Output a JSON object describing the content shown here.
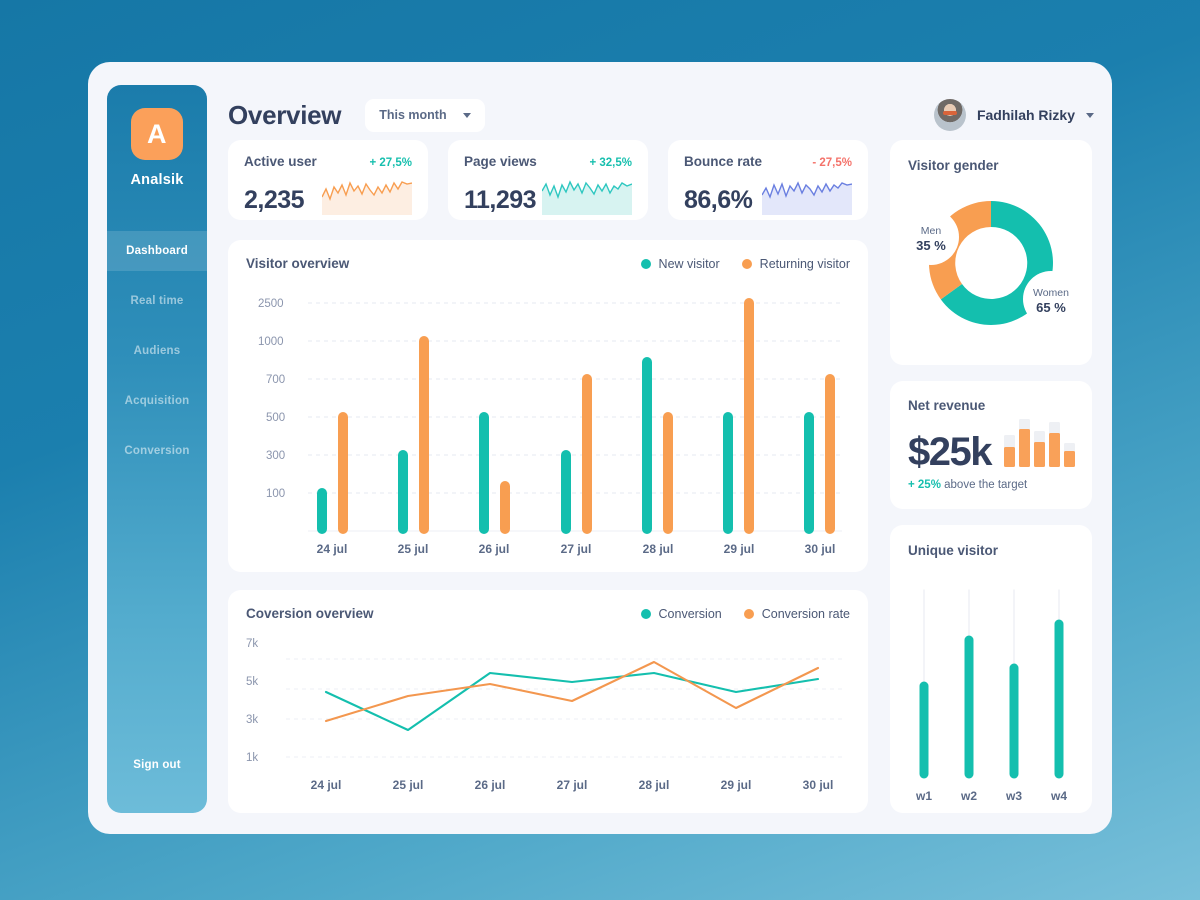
{
  "brand": {
    "logo_letter": "A",
    "name": "Analsik"
  },
  "sidebar": {
    "items": [
      {
        "label": "Dashboard",
        "active": true
      },
      {
        "label": "Real time",
        "active": false
      },
      {
        "label": "Audiens",
        "active": false
      },
      {
        "label": "Acquisition",
        "active": false
      },
      {
        "label": "Conversion",
        "active": false
      }
    ],
    "signout_label": "Sign out"
  },
  "header": {
    "title": "Overview",
    "period": "This month",
    "user_name": "Fadhilah Rizky"
  },
  "stats": [
    {
      "label": "Active user",
      "delta": "+ 27,5%",
      "direction": "up",
      "value": "2,235",
      "spark_color": "#f89e51",
      "spark_fill": "#fdeee2"
    },
    {
      "label": "Page views",
      "delta": "+ 32,5%",
      "direction": "up",
      "value": "11,293",
      "spark_color": "#2ec7c0",
      "spark_fill": "#d7f3f1"
    },
    {
      "label": "Bounce rate",
      "delta": "- 27,5%",
      "direction": "down",
      "value": "86,6%",
      "spark_color": "#6a7fe0",
      "spark_fill": "#e3e7fa"
    }
  ],
  "colors": {
    "teal": "#14bfae",
    "orange": "#f89e51",
    "ink": "#33405e",
    "muted": "#8b95ad"
  },
  "chart_data": [
    {
      "id": "visitor_overview",
      "type": "bar",
      "title": "Visitor overview",
      "legend": [
        "New visitor",
        "Returning visitor"
      ],
      "legend_position": "top-right",
      "categories": [
        "24 jul",
        "25 jul",
        "26 jul",
        "27 jul",
        "28 jul",
        "29 jul",
        "30 jul"
      ],
      "ytick_labels": [
        "2500",
        "1000",
        "700",
        "500",
        "300",
        "100"
      ],
      "grid": true,
      "xlabel": "",
      "ylabel": "",
      "series": [
        {
          "name": "New visitor",
          "color": "#14bfae",
          "values": [
            100,
            300,
            500,
            300,
            700,
            500,
            500
          ]
        },
        {
          "name": "Returning visitor",
          "color": "#f89e51",
          "values": [
            500,
            1000,
            150,
            700,
            500,
            2500,
            700
          ]
        }
      ]
    },
    {
      "id": "coversion_overview",
      "type": "line",
      "title": "Coversion overview",
      "legend": [
        "Conversion",
        "Conversion rate"
      ],
      "legend_position": "top-right",
      "categories": [
        "24 jul",
        "25 jul",
        "26 jul",
        "27 jul",
        "28 jul",
        "29 jul",
        "30 jul"
      ],
      "ytick_labels": [
        "7k",
        "5k",
        "3k",
        "1k"
      ],
      "ylim": [
        1000,
        7000
      ],
      "grid": true,
      "series": [
        {
          "name": "Conversion",
          "color": "#14bfae",
          "values": [
            4650,
            2800,
            5700,
            5250,
            5700,
            4650,
            5350
          ]
        },
        {
          "name": "Conversion rate",
          "color": "#f89e51",
          "values": [
            3000,
            4500,
            5100,
            4250,
            6250,
            3700,
            5900
          ]
        }
      ]
    },
    {
      "id": "visitor_gender",
      "type": "pie",
      "title": "Visitor gender",
      "labels": [
        "Women",
        "Men"
      ],
      "values": [
        65,
        35
      ],
      "value_labels": [
        "65 %",
        "35 %"
      ],
      "colors": [
        "#14bfae",
        "#f89e51"
      ],
      "donut": true
    },
    {
      "id": "net_revenue",
      "type": "bar",
      "title": "Net revenue",
      "values": [
        45,
        85,
        55,
        75,
        35
      ],
      "track_values": [
        70,
        100,
        78,
        95,
        52
      ],
      "color": "#f9a159",
      "track_color": "#eef0f4"
    },
    {
      "id": "unique_visitor",
      "type": "bar",
      "title": "Unique visitor",
      "categories": [
        "w1",
        "w2",
        "w3",
        "w4"
      ],
      "values": [
        48,
        72,
        58,
        80
      ],
      "track_values": [
        100,
        100,
        100,
        100
      ],
      "color": "#14bfae",
      "track_color": "#f0f2f6"
    }
  ],
  "net_revenue": {
    "title": "Net revenue",
    "value": "$25k",
    "note_highlight": "+ 25%",
    "note_rest": " above the target"
  },
  "gender": {
    "title": "Visitor gender",
    "men_label": "Men",
    "men_value": "35 %",
    "women_label": "Women",
    "women_value": "65 %"
  },
  "unique_visitor": {
    "title": "Unique visitor"
  }
}
